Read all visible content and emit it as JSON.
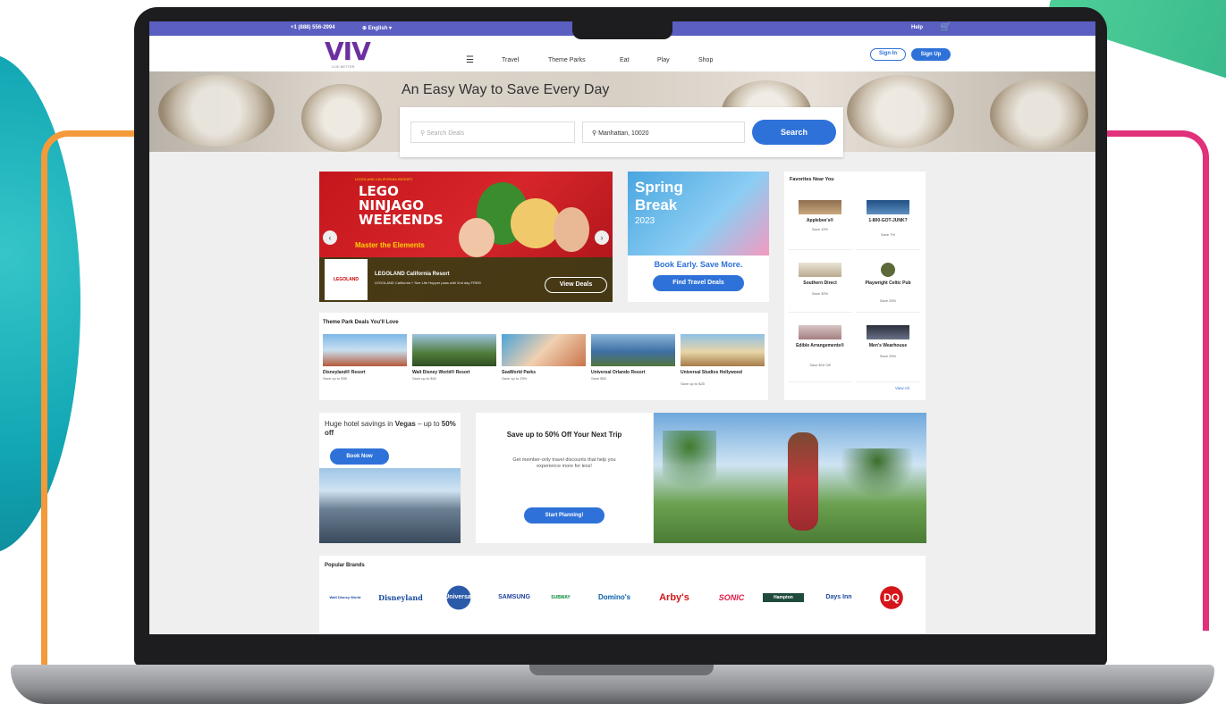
{
  "topbar": {
    "phone": "+1 (888) 556-2994",
    "language": "English",
    "help": "Help"
  },
  "nav": {
    "logo": "VIV",
    "logo_tag": "LIVE BETTER",
    "items": [
      "Travel",
      "Theme Parks",
      "Eat",
      "Play",
      "Shop"
    ],
    "sign_in": "Sign In",
    "sign_up": "Sign Up"
  },
  "hero": {
    "title": "An Easy Way to Save Every Day",
    "search_placeholder": "Search Deals",
    "location": "Manhattan, 10020",
    "search_button": "Search"
  },
  "lego": {
    "tag": "LEGOLAND CALIFORNIA RESORT",
    "headline_lines": [
      "LEGO",
      "NINJAGO",
      "WEEKENDS"
    ],
    "sub": "Master the Elements",
    "logo": "LEGOLAND",
    "title": "LEGOLAND California Resort",
    "desc": "LEGOLAND California + See Life Hopper pass with 2nd day FREE!",
    "cta": "View Deals"
  },
  "spring": {
    "title_lines": [
      "Spring",
      "Break"
    ],
    "year": "2023",
    "tagline": "Book Early. Save More.",
    "cta": "Find Travel Deals"
  },
  "favorites": {
    "heading": "Favorites Near You",
    "items": [
      {
        "name": "Applebee's®",
        "save": "Save 10%"
      },
      {
        "name": "1-800-GOT-JUNK?",
        "save": "Save 7%"
      },
      {
        "name": "Southern Direct",
        "save": "Save 30%"
      },
      {
        "name": "Playwright Celtic Pub",
        "save": "Save 25%"
      },
      {
        "name": "Edible Arrangements®",
        "save": "Save $10 Off"
      },
      {
        "name": "Men's Wearhouse",
        "save": "Save 25%"
      }
    ],
    "view_all": "View All"
  },
  "theme_parks": {
    "heading": "Theme Park Deals You'll Love",
    "items": [
      {
        "name": "Disneyland® Resort",
        "save": "Save up to $35"
      },
      {
        "name": "Walt Disney World® Resort",
        "save": "Save up to $40"
      },
      {
        "name": "SeaWorld Parks",
        "save": "Save up to 25%"
      },
      {
        "name": "Universal Orlando Resort",
        "save": "Save $50"
      },
      {
        "name": "Universal Studios Hollywood",
        "save": "Save up to $25"
      }
    ]
  },
  "vegas": {
    "text_a": "Huge hotel savings in ",
    "text_b": "Vegas",
    "text_c": " – up to ",
    "text_d": "50% off",
    "cta": "Book Now"
  },
  "save_promo": {
    "heading": "Save up to 50% Off Your Next Trip",
    "body": "Get member-only travel discounts that help you experience more for less!",
    "cta": "Start Planning!"
  },
  "brands": {
    "heading": "Popular Brands",
    "items": [
      "Walt Disney World",
      "Disneyland",
      "Universal",
      "SAMSUNG",
      "SUBWAY",
      "Domino's",
      "Arby's",
      "SONIC",
      "Hampton",
      "Days Inn",
      "DQ"
    ]
  },
  "colors": {
    "accent": "#2e72d9",
    "topbar": "#5a5fc1",
    "logo": "#6b2fa0"
  }
}
